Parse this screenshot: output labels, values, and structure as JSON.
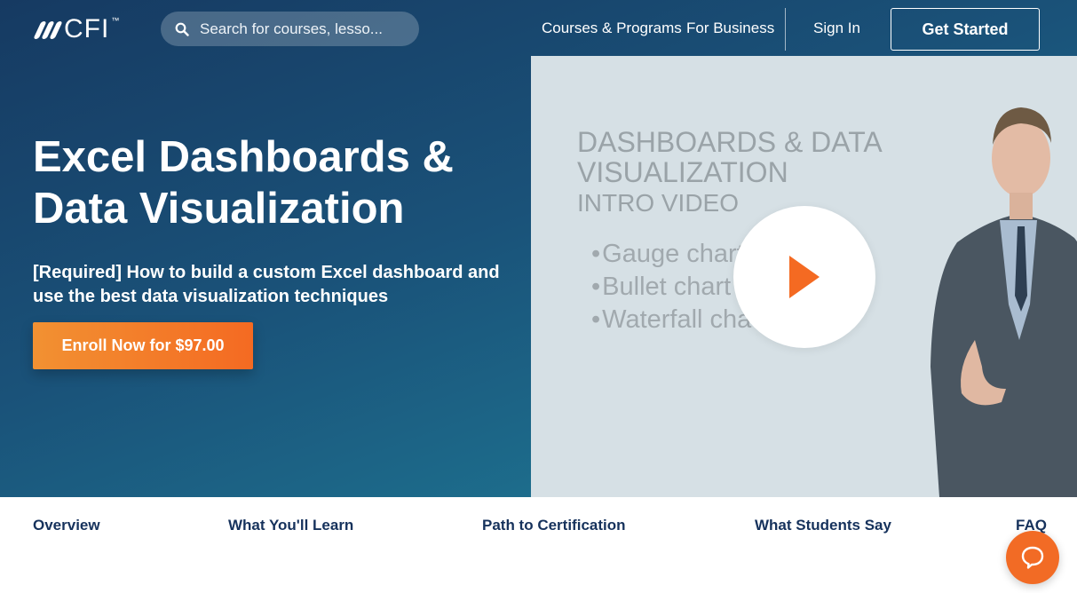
{
  "header": {
    "logo_text": "CFI",
    "logo_tm": "™",
    "search": {
      "placeholder": "Search for courses, lesso..."
    },
    "nav": {
      "courses_programs": "Courses & Programs",
      "for_business": "For Business",
      "sign_in": "Sign In",
      "get_started": "Get Started"
    }
  },
  "hero": {
    "title": "Excel Dashboards & Data Visualization",
    "subtitle": "[Required] How to build a custom Excel dashboard and use the best data visualization techniques",
    "enroll_label": "Enroll Now for $97.00"
  },
  "video": {
    "heading_line1": "DASHBOARDS & DATA",
    "heading_line2": "VISUALIZATION",
    "subheading": "INTRO VIDEO",
    "bullets": [
      "Gauge chart",
      "Bullet chart",
      "Waterfall cha"
    ]
  },
  "tabs": [
    "Overview",
    "What You'll Learn",
    "Path to Certification",
    "What Students Say",
    "FAQ"
  ],
  "colors": {
    "hero_gradient_start": "#163a62",
    "hero_gradient_end": "#1f7f99",
    "accent_orange": "#f46a22",
    "tab_text": "#16325c",
    "video_bg": "#d6e0e5"
  },
  "icons": {
    "search": "search-icon",
    "play": "play-icon",
    "chat": "chat-icon"
  }
}
